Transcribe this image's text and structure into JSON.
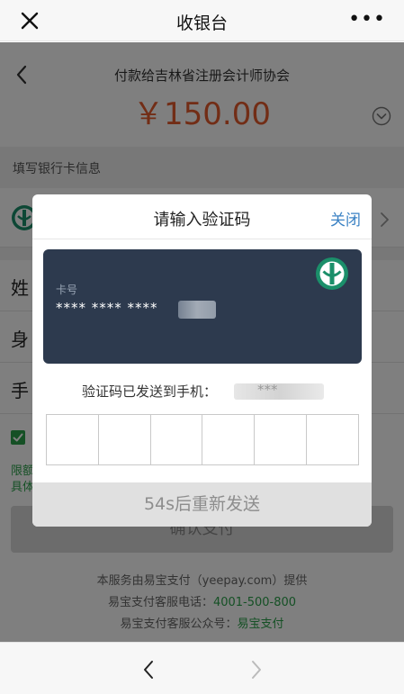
{
  "topbar": {
    "title": "收银台",
    "more_label": "•••",
    "close_icon": "close-x-icon"
  },
  "payment": {
    "payee": "付款给吉林省注册会计师协会",
    "amount": "￥150.00"
  },
  "section": {
    "bank_info_label": "填写银行卡信息"
  },
  "form": {
    "rows": [
      {
        "label": "姓"
      },
      {
        "label": "身"
      },
      {
        "label": "手"
      }
    ],
    "agree_fragment": "",
    "limit_text_1": "限额",
    "limit_text_2": "具体"
  },
  "confirm_button": {
    "label": "确认支付"
  },
  "footer": {
    "line1": "本服务由易宝支付（yeepay.com）提供",
    "line2_prefix": "易宝支付客服电话：",
    "line2_phone": "4001-500-800",
    "line3_prefix": "易宝支付客服公众号：",
    "line3_account": "易宝支付"
  },
  "modal": {
    "title": "请输入验证码",
    "close_label": "关闭",
    "card": {
      "label": "卡号",
      "number_masked": "**** **** ****"
    },
    "sent_label": "验证码已发送到手机：",
    "phone_masked": "***",
    "code_box_count": 6,
    "resend_label": "54s后重新发送"
  },
  "colors": {
    "accent_green": "#2aa14a",
    "amount_orange": "#e45b2c",
    "card_navy": "#2d3a4e",
    "link_blue": "#3b82c4"
  }
}
